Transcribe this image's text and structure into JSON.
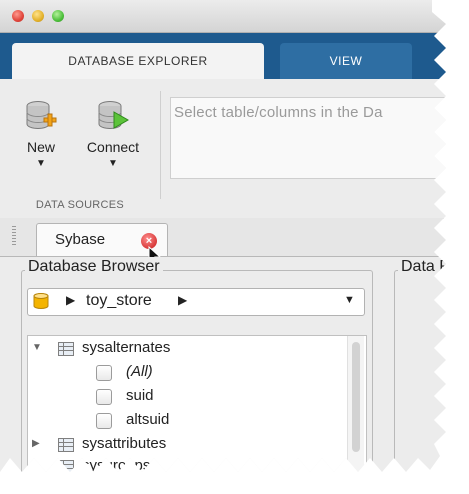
{
  "window": {
    "controls": [
      "close",
      "minimize",
      "zoom"
    ]
  },
  "ribbon": {
    "tabs": [
      {
        "label": "DATABASE EXPLORER",
        "active": true
      },
      {
        "label": "VIEW",
        "active": false
      }
    ],
    "buttons": {
      "new_label": "New",
      "connect_label": "Connect"
    },
    "group_label": "DATA SOURCES",
    "selection_hint": "Select table/columns in the Da"
  },
  "document_tab": {
    "label": "Sybase"
  },
  "database_browser": {
    "title": "Database Browser",
    "data_source": "toy_store",
    "tree": [
      {
        "type": "table",
        "label": "sysalternates",
        "expanded": true
      },
      {
        "type": "column",
        "label": "(All)"
      },
      {
        "type": "column",
        "label": "suid"
      },
      {
        "type": "column",
        "label": "altsuid"
      },
      {
        "type": "table",
        "label": "sysattributes",
        "expanded": false
      },
      {
        "type": "table",
        "label": "sysgroups",
        "expanded": false
      }
    ]
  },
  "data_panel": {
    "title": "Data P"
  },
  "colors": {
    "ribbon_blue": "#1e5a8e",
    "view_tab_blue": "#2e6ea3",
    "toolstrip_gray": "#ececec",
    "close_red": "#d83a3a"
  }
}
